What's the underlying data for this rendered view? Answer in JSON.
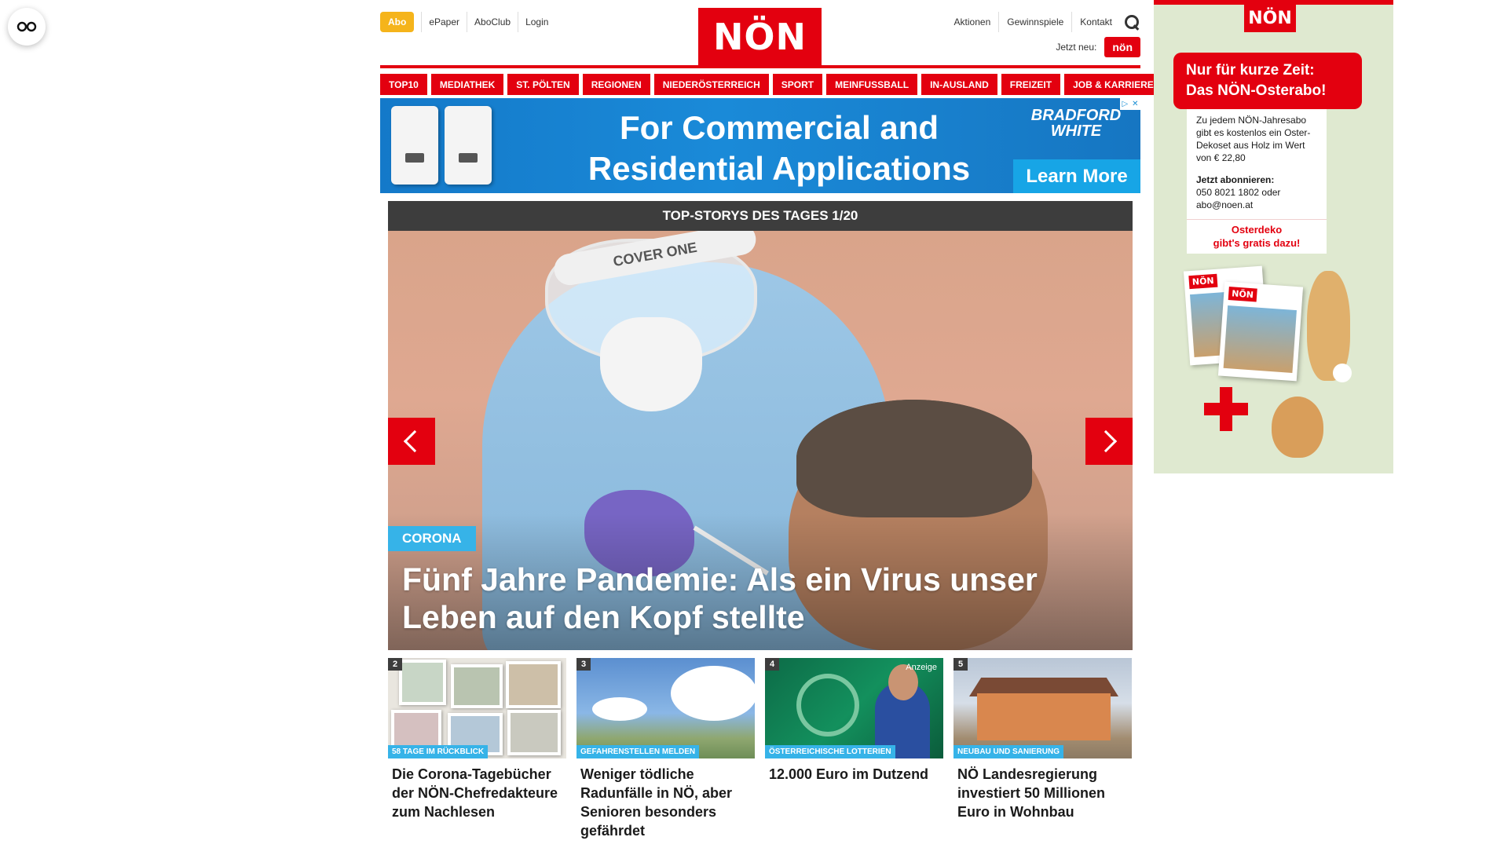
{
  "header": {
    "abo": "Abo",
    "links_left": [
      "ePaper",
      "AboClub",
      "Login"
    ],
    "logo": "NÖN",
    "links_right": [
      "Aktionen",
      "Gewinnspiele",
      "Kontakt"
    ],
    "jetzt_neu": "Jetzt neu:",
    "jetzt_badge": "nön"
  },
  "main_nav": [
    "TOP10",
    "MEDIATHEK",
    "ST. PÖLTEN",
    "REGIONEN",
    "NIEDERÖSTERREICH",
    "SPORT",
    "MEINFUSSBALL",
    "IN-AUSLAND",
    "FREIZEIT",
    "JOB & KARRIERE"
  ],
  "ad_banner": {
    "text_line1": "For Commercial and",
    "text_line2": "Residential Applications",
    "brand_line1": "BRADFORD",
    "brand_line2": "WHITE",
    "cta": "Learn More"
  },
  "slider": {
    "heading": "TOP-STORYS DES TAGES 1/20",
    "category": "CORONA",
    "title": "Fünf Jahre Pandemie: Als ein Virus unser Leben auf den Kopf stellte",
    "visor_text": "COVER ONE"
  },
  "cards": [
    {
      "num": "2",
      "category": "58 TAGE IM RÜCKBLICK",
      "title": "Die Corona-Tagebücher der NÖN-Chefredakteure zum Nachlesen"
    },
    {
      "num": "3",
      "category": "GEFAHRENSTELLEN MELDEN",
      "title": "Weniger tödliche Radunfälle in NÖ, aber Senioren besonders gefährdet"
    },
    {
      "num": "4",
      "category": "ÖSTERREICHISCHE LOTTERIEN",
      "title": "12.000 Euro im Dutzend",
      "badge": "Anzeige"
    },
    {
      "num": "5",
      "category": "NEUBAU UND SANIERUNG",
      "title": "NÖ Landesregierung investiert 50 Millionen Euro in Wohnbau"
    }
  ],
  "side_ad": {
    "logo": "NÖN",
    "headline_line1": "Nur für kurze Zeit:",
    "headline_line2": "Das NÖN-Osterabo!",
    "body1": "Zu jedem NÖN-Jahresabo gibt es kostenlos ein Oster-Dekoset aus Holz im Wert von € 22,80",
    "body2_label": "Jetzt abonnieren:",
    "body2": "050 8021 1802 oder abo@noen.at",
    "osterdeko_line1": "Osterdeko",
    "osterdeko_line2": "gibt's gratis dazu!",
    "np_logo": "NÖN"
  },
  "colors": {
    "brand_red": "#e3000f",
    "abo_yellow": "#f5b41b",
    "category_blue": "#36b3e8",
    "dark_bar": "#3d3d3d"
  }
}
